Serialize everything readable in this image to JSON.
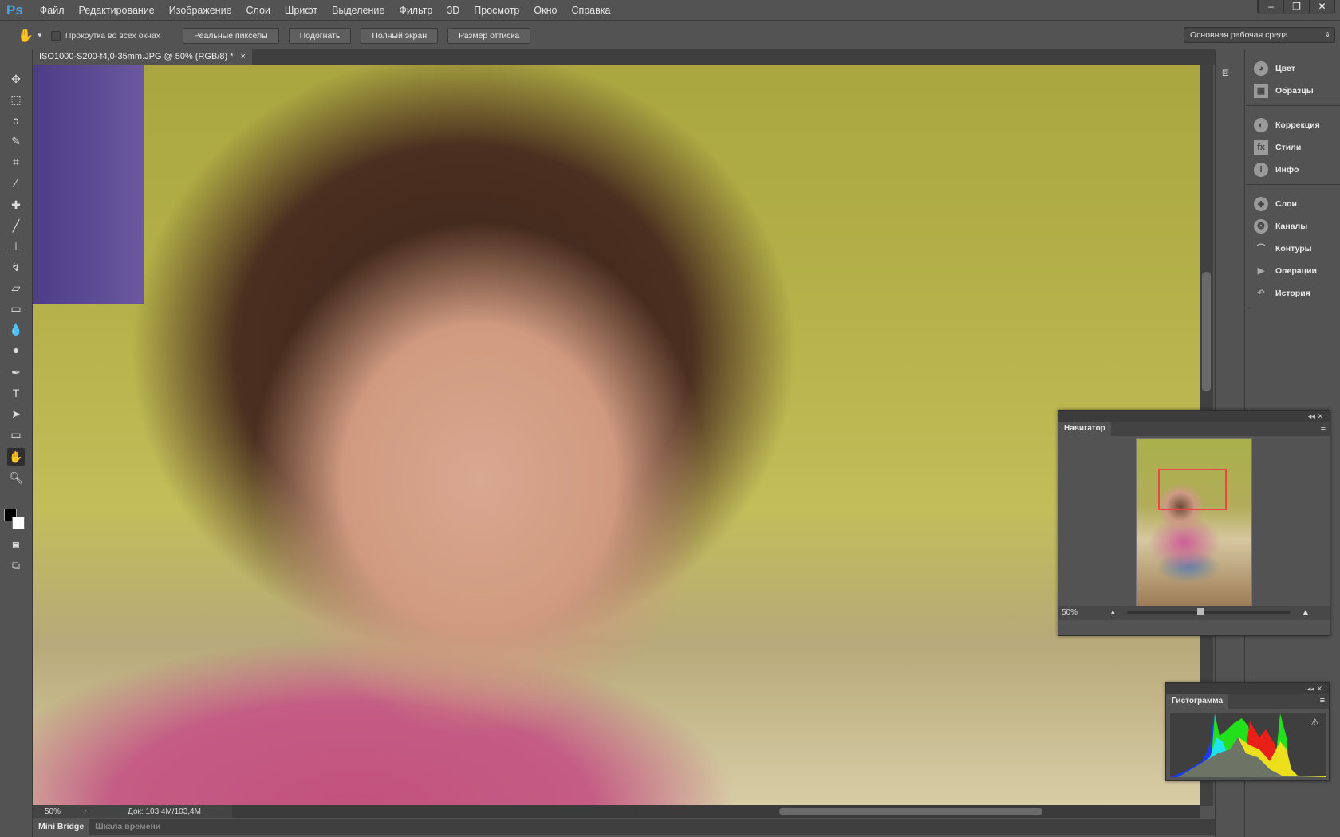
{
  "app": {
    "logo": "Ps",
    "window_controls": [
      "minimize",
      "restore",
      "close"
    ]
  },
  "menu": [
    "Файл",
    "Редактирование",
    "Изображение",
    "Слои",
    "Шрифт",
    "Выделение",
    "Фильтр",
    "3D",
    "Просмотр",
    "Окно",
    "Справка"
  ],
  "options": {
    "scroll_all_label": "Прокрутка во всех окнах",
    "buttons": [
      "Реальные пикселы",
      "Подогнать",
      "Полный экран",
      "Размер оттиска"
    ],
    "workspace": "Основная рабочая среда"
  },
  "document": {
    "tab_title": "ISO1000-S200-f4,0-35mm.JPG @ 50% (RGB/8) *",
    "zoom": "50%",
    "doc_size": "Док: 103,4M/103,4M"
  },
  "bottom_tabs": [
    "Mini Bridge",
    "Шкала времени"
  ],
  "dock": {
    "groups": [
      [
        "Цвет",
        "Образцы"
      ],
      [
        "Коррекция",
        "Стили",
        "Инфо"
      ],
      [
        "Слои",
        "Каналы",
        "Контуры",
        "Операции",
        "История"
      ]
    ]
  },
  "navigator": {
    "title": "Навигатор",
    "zoom": "50%",
    "slider_fraction": 0.45
  },
  "histogram": {
    "title": "Гистограмма"
  },
  "colors": {
    "accent": "#4aa3e0",
    "nav_box": "#ef4444"
  }
}
